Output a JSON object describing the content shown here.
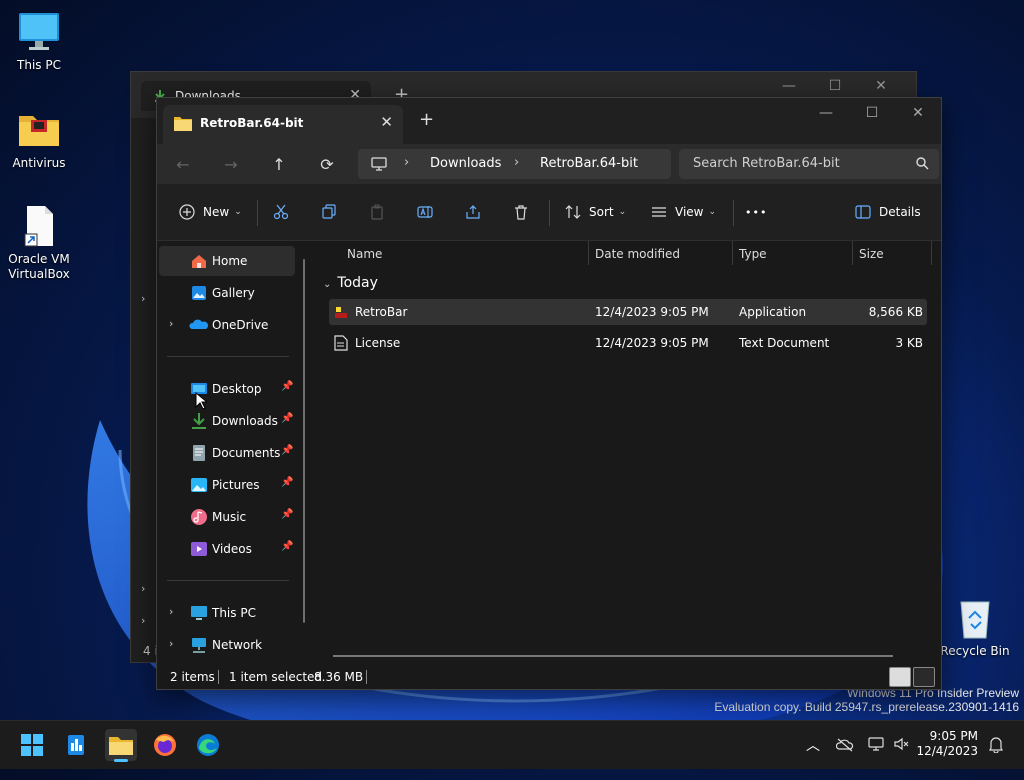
{
  "desktop": {
    "icons": [
      {
        "label": "This PC",
        "icon": "monitor-icon"
      },
      {
        "label": "Antivirus",
        "icon": "folder-icon"
      },
      {
        "label": "Oracle VM VirtualBox",
        "icon": "file-shortcut-icon"
      },
      {
        "label": "Recycle Bin",
        "icon": "recycle-bin-icon"
      }
    ],
    "watermark": {
      "line1": "Windows 11 Pro Insider Preview",
      "line2": "Evaluation copy. Build 25947.rs_prerelease.230901-1416"
    }
  },
  "background_window": {
    "tab_title": "Downloads",
    "close_glyph": "✕",
    "new_tab_glyph": "+",
    "partial_text": "4 i"
  },
  "window": {
    "tab_title": "RetroBar.64-bit",
    "tab_close_glyph": "✕",
    "new_tab_glyph": "+",
    "caption": {
      "minimize": "—",
      "maximize": "☐",
      "close": "✕"
    },
    "breadcrumb": [
      "Downloads",
      "RetroBar.64-bit"
    ],
    "search_placeholder": "Search RetroBar.64-bit",
    "toolbar": {
      "new_label": "New",
      "sort_label": "Sort",
      "view_label": "View",
      "more_label": "•••",
      "details_label": "Details"
    },
    "navigation": {
      "top": [
        {
          "label": "Home",
          "icon": "home-icon",
          "selected": true
        },
        {
          "label": "Gallery",
          "icon": "gallery-icon"
        },
        {
          "label": "OneDrive",
          "icon": "onedrive-icon",
          "expandable": true
        }
      ],
      "pinned": [
        {
          "label": "Desktop",
          "icon": "desktop-folder-icon"
        },
        {
          "label": "Downloads",
          "icon": "downloads-icon"
        },
        {
          "label": "Documents",
          "icon": "documents-icon"
        },
        {
          "label": "Pictures",
          "icon": "pictures-icon"
        },
        {
          "label": "Music",
          "icon": "music-icon"
        },
        {
          "label": "Videos",
          "icon": "videos-icon"
        }
      ],
      "bottom": [
        {
          "label": "This PC",
          "icon": "this-pc-icon"
        },
        {
          "label": "Network",
          "icon": "network-icon"
        }
      ]
    },
    "columns": [
      "Name",
      "Date modified",
      "Type",
      "Size"
    ],
    "group_label": "Today",
    "files": [
      {
        "name": "RetroBar",
        "date": "12/4/2023 9:05 PM",
        "type": "Application",
        "size": "8,566 KB",
        "icon": "retrobar-app-icon",
        "selected": true
      },
      {
        "name": "License",
        "date": "12/4/2023 9:05 PM",
        "type": "Text Document",
        "size": "3 KB",
        "icon": "text-file-icon",
        "selected": false
      }
    ],
    "status": {
      "items": "2 items",
      "selected": "1 item selected",
      "size": "8.36 MB"
    }
  },
  "taskbar": {
    "apps": [
      "start-icon",
      "widgets-icon",
      "file-explorer-icon",
      "firefox-icon",
      "edge-icon"
    ],
    "clock_time": "9:05 PM",
    "clock_date": "12/4/2023"
  }
}
